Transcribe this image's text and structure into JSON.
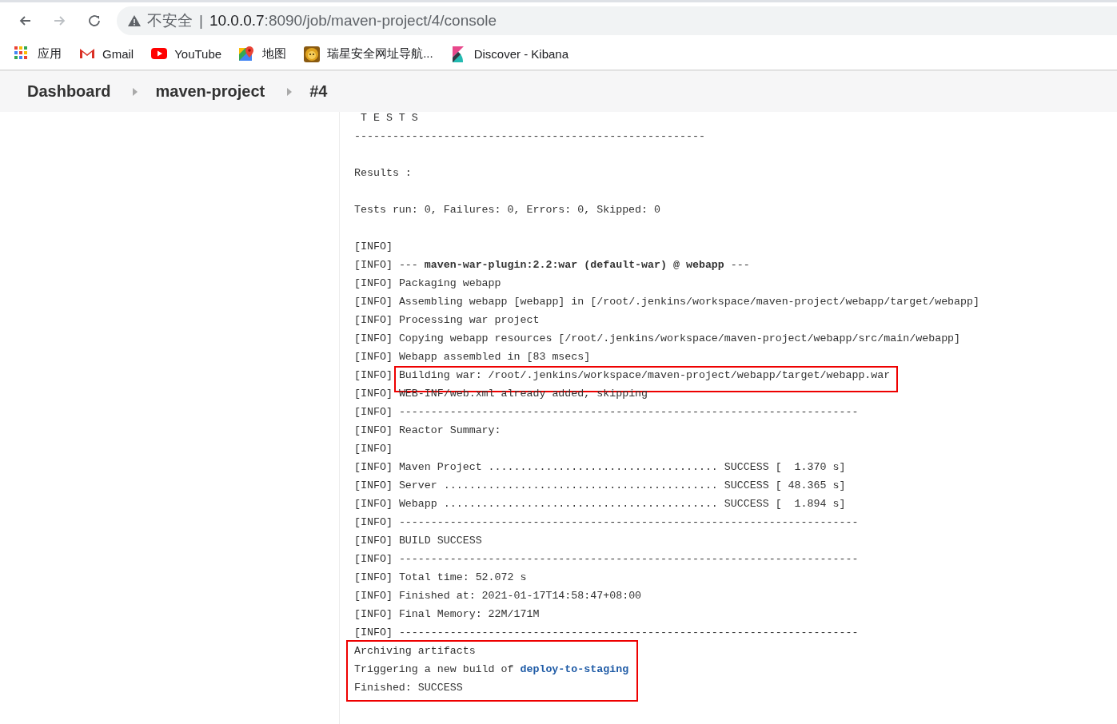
{
  "browser": {
    "nav": [
      {
        "kind": "back",
        "disabled": false
      },
      {
        "kind": "forward",
        "disabled": true
      },
      {
        "kind": "reload",
        "disabled": false
      }
    ],
    "security_label": "不安全",
    "separator": "|",
    "url_host": "10.0.0.7",
    "url_path": ":8090/job/maven-project/4/console"
  },
  "bookmarks": [
    {
      "kind": "apps",
      "label": "应用"
    },
    {
      "kind": "gmail",
      "label": "Gmail"
    },
    {
      "kind": "youtube",
      "label": "YouTube"
    },
    {
      "kind": "maps",
      "label": "地图"
    },
    {
      "kind": "lion",
      "label": "瑞星安全网址导航..."
    },
    {
      "kind": "kibana",
      "label": "Discover - Kibana"
    }
  ],
  "breadcrumbs": [
    "Dashboard",
    "maven-project",
    "#4"
  ],
  "console": [
    {
      "lines": [
        {
          "text": " T E S T S"
        },
        {
          "text": "-------------------------------------------------------"
        },
        {
          "text": "Results :",
          "gap_before": true
        },
        {
          "text": "Tests run: 0, Failures: 0, Errors: 0, Skipped: 0",
          "gap_before": true
        },
        {
          "prefix": "[INFO]",
          "gap_before": true
        },
        {
          "prefix": "[INFO]",
          "text": "--- **maven-war-plugin:2.2:war (default-war) @ webapp** ---"
        },
        {
          "prefix": "[INFO]",
          "text": "Packaging webapp"
        },
        {
          "prefix": "[INFO]",
          "text": "Assembling webapp [webapp] in [/root/.jenkins/workspace/maven-project/webapp/target/webapp]"
        },
        {
          "prefix": "[INFO]",
          "text": "Processing war project"
        },
        {
          "prefix": "[INFO]",
          "text": "Copying webapp resources [/root/.jenkins/workspace/maven-project/webapp/src/main/webapp]"
        },
        {
          "prefix": "[INFO]",
          "text": "Webapp assembled in [83 msecs]"
        },
        {
          "prefix": "[INFO]",
          "text": "Building war: /root/.jenkins/workspace/maven-project/webapp/target/webapp.war",
          "highlight": true
        },
        {
          "prefix": "[INFO]",
          "text": "WEB-INF/web.xml already added, skipping"
        },
        {
          "prefix": "[INFO]",
          "text": "------------------------------------------------------------------------"
        },
        {
          "prefix": "[INFO]",
          "text": "Reactor Summary:"
        },
        {
          "prefix": "[INFO]"
        },
        {
          "prefix": "[INFO]",
          "text": "Maven Project .................................... SUCCESS [  1.370 s]"
        },
        {
          "prefix": "[INFO]",
          "text": "Server ........................................... SUCCESS [ 48.365 s]"
        },
        {
          "prefix": "[INFO]",
          "text": "Webapp ........................................... SUCCESS [  1.894 s]"
        },
        {
          "prefix": "[INFO]",
          "text": "------------------------------------------------------------------------"
        },
        {
          "prefix": "[INFO]",
          "text": "BUILD SUCCESS"
        },
        {
          "prefix": "[INFO]",
          "text": "------------------------------------------------------------------------"
        },
        {
          "prefix": "[INFO]",
          "text": "Total time: 52.072 s"
        },
        {
          "prefix": "[INFO]",
          "text": "Finished at: 2021-01-17T14:58:47+08:00"
        },
        {
          "prefix": "[INFO]",
          "text": "Final Memory: 22M/171M"
        },
        {
          "prefix": "[INFO]",
          "text": "------------------------------------------------------------------------"
        }
      ],
      "highlight": false
    },
    {
      "lines": [
        {
          "text": "Archiving artifacts"
        },
        {
          "text": "Triggering a new build of ",
          "link": "deploy-to-staging"
        },
        {
          "text": "Finished: SUCCESS"
        }
      ],
      "highlight": true
    }
  ]
}
